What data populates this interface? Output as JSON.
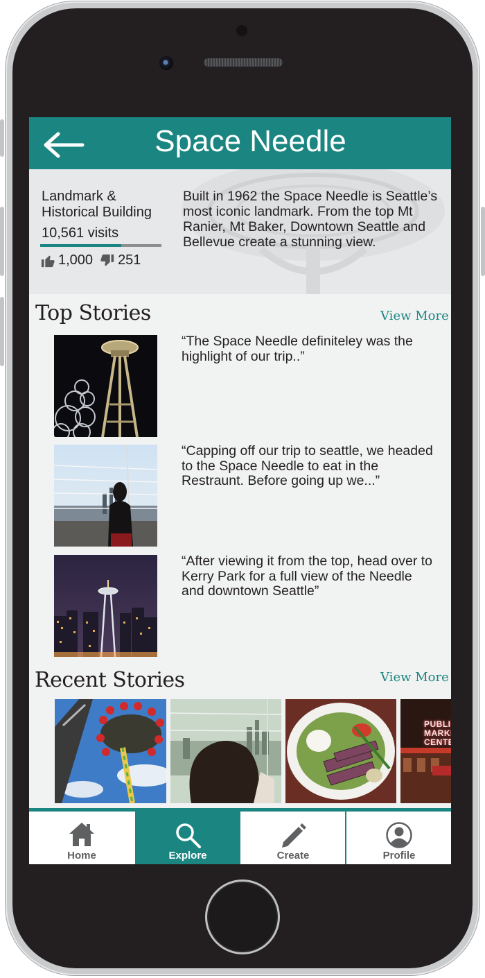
{
  "header": {
    "title": "Space Needle"
  },
  "info": {
    "category": "Landmark & Historical Building",
    "visits": "10,561 visits",
    "visits_progress": 0.67,
    "likes": "1,000",
    "dislikes": "251",
    "description": "Built in 1962 the Space Needle is Seattle’s most iconic landmark. From the top Mt Ranier, Mt Baker, Downtown Seattle and Bellevue create a stunning view."
  },
  "top_stories": {
    "title": "Top Stories",
    "view_more": "View More",
    "items": [
      {
        "quote": "“The Space Needle definiteley was the highlight of our trip..”"
      },
      {
        "quote": "“Capping off our trip to seattle, we headed to the Space Needle to eat in the Restraunt. Before going up we...”"
      },
      {
        "quote": "“After viewing it from the top, head over to Kerry Park for a full view of the Needle and downtown Seattle”"
      }
    ]
  },
  "recent_stories": {
    "title": "Recent Stories",
    "view_more": "View More",
    "sign_text": "PUBLIC MARKET CENTER"
  },
  "tabbar": {
    "items": [
      {
        "label": "Home",
        "icon": "home-icon",
        "active": false
      },
      {
        "label": "Explore",
        "icon": "search-icon",
        "active": true
      },
      {
        "label": "Create",
        "icon": "pencil-icon",
        "active": false
      },
      {
        "label": "Profile",
        "icon": "user-icon",
        "active": false
      }
    ]
  },
  "colors": {
    "accent": "#1b8681",
    "background": "#f1f2f2",
    "text": "#231f20"
  }
}
